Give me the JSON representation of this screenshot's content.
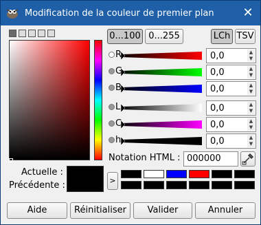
{
  "window": {
    "title": "Modification de la couleur de premier plan",
    "close_glyph": "✕"
  },
  "selector_modes": [
    "gimp",
    "cmyk",
    "scales",
    "wheel",
    "watercolor"
  ],
  "range_buttons": {
    "r100": "0...100",
    "r255": "0...255"
  },
  "space_buttons": {
    "lch": "LCh",
    "tsv": "TSV"
  },
  "channels": [
    {
      "label": "R",
      "value": "0,0",
      "color_end": "#ff0000",
      "selected": true
    },
    {
      "label": "G",
      "value": "0,0",
      "color_end": "#00ff00",
      "selected": false
    },
    {
      "label": "B",
      "value": "0,0",
      "color_end": "#0000ff",
      "selected": false
    },
    {
      "label": "L",
      "value": "0,0",
      "color_end": "#ffffff",
      "selected": false
    },
    {
      "label": "C",
      "value": "0,0",
      "color_end": "#ff00ff",
      "selected": false
    },
    {
      "label": "h",
      "value": "0,0",
      "color_end": "#000000",
      "selected": false
    }
  ],
  "html_notation": {
    "label": "Notation HTML :",
    "value": "000000"
  },
  "current_label": "Actuelle :",
  "previous_label": "Précédente :",
  "current_color": "#000000",
  "history_toggle": ">",
  "history": [
    "#000000",
    "#ffffff",
    "#0000ff",
    "#ff0000",
    "#000000",
    "#000000",
    "#000000",
    "#000000",
    "#000000",
    "#000000",
    "#000000",
    "#000000"
  ],
  "buttons": {
    "help": "Aide",
    "reset": "Réinitialiser",
    "ok": "Valider",
    "cancel": "Annuler"
  }
}
